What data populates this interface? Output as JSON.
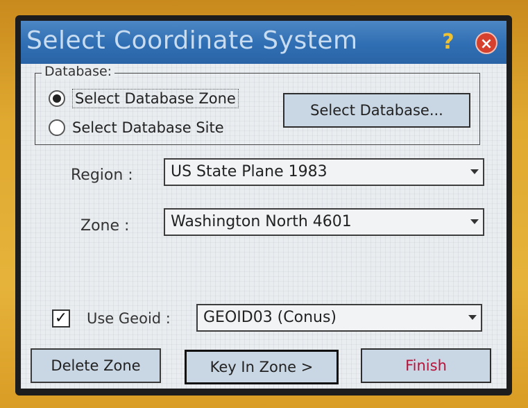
{
  "dialog": {
    "title": "Select Coordinate System",
    "help_icon": "?",
    "close_icon": "×"
  },
  "database": {
    "legend": "Database:",
    "option_zone_label": "Select Database Zone",
    "option_site_label": "Select Database Site",
    "selected": "zone",
    "select_button_label": "Select Database..."
  },
  "region": {
    "label": "Region :",
    "value": "US State Plane 1983"
  },
  "zone": {
    "label": "Zone :",
    "value": "Washington North 4601"
  },
  "geoid": {
    "checked": true,
    "check_mark": "✓",
    "label": "Use Geoid :",
    "value": "GEOID03 (Conus)"
  },
  "footer": {
    "delete_label": "Delete Zone",
    "key_in_label": "Key In Zone >",
    "finish_label": "Finish"
  },
  "colors": {
    "title_bar": "#2f6eb3",
    "button_face": "#c9d6e3",
    "finish_text": "#b8123a",
    "close_button": "#d6412e",
    "housing": "#e0a930"
  }
}
